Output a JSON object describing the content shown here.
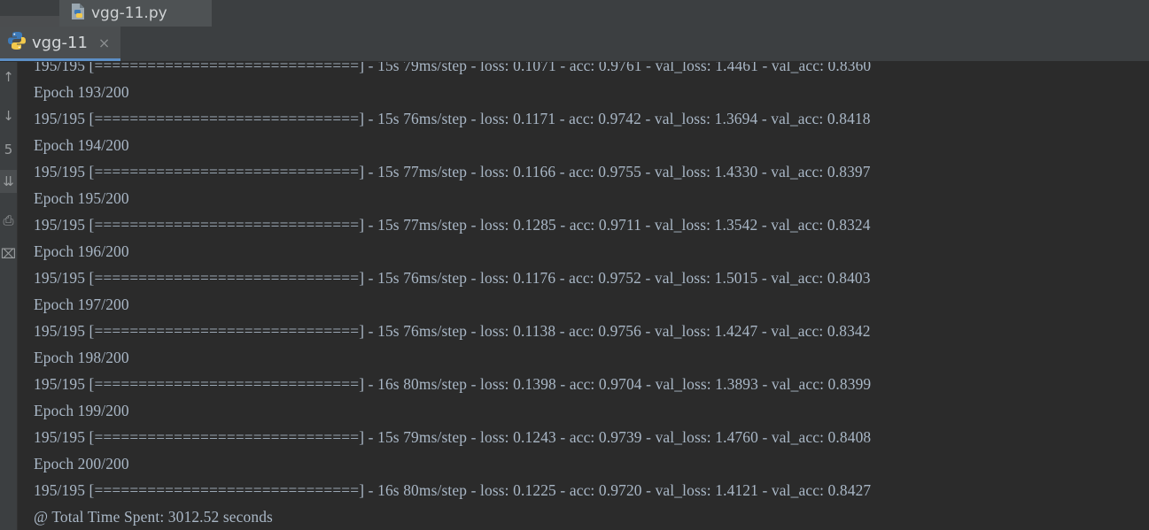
{
  "editor_tab": {
    "label": "vgg-11.py",
    "icon": "python-file-icon"
  },
  "run_tab": {
    "label": "vgg-11",
    "icon": "python-run-icon",
    "close_glyph": "×"
  },
  "gutter_buttons": [
    {
      "name": "up-arrow-icon",
      "glyph": "↑"
    },
    {
      "name": "down-arrow-icon",
      "glyph": "↓"
    },
    {
      "name": "rerun-icon",
      "glyph": "5"
    },
    {
      "name": "scroll-to-end-icon",
      "glyph": "⇊"
    },
    {
      "name": "print-icon",
      "glyph": "⎙"
    },
    {
      "name": "trash-icon",
      "glyph": "⌧"
    }
  ],
  "console": {
    "lines": [
      "195/195 [==============================] - 15s 79ms/step - loss: 0.1071 - acc: 0.9761 - val_loss: 1.4461 - val_acc: 0.8360",
      "Epoch 193/200",
      "195/195 [==============================] - 15s 76ms/step - loss: 0.1171 - acc: 0.9742 - val_loss: 1.3694 - val_acc: 0.8418",
      "Epoch 194/200",
      "195/195 [==============================] - 15s 77ms/step - loss: 0.1166 - acc: 0.9755 - val_loss: 1.4330 - val_acc: 0.8397",
      "Epoch 195/200",
      "195/195 [==============================] - 15s 77ms/step - loss: 0.1285 - acc: 0.9711 - val_loss: 1.3542 - val_acc: 0.8324",
      "Epoch 196/200",
      "195/195 [==============================] - 15s 76ms/step - loss: 0.1176 - acc: 0.9752 - val_loss: 1.5015 - val_acc: 0.8403",
      "Epoch 197/200",
      "195/195 [==============================] - 15s 76ms/step - loss: 0.1138 - acc: 0.9756 - val_loss: 1.4247 - val_acc: 0.8342",
      "Epoch 198/200",
      "195/195 [==============================] - 16s 80ms/step - loss: 0.1398 - acc: 0.9704 - val_loss: 1.3893 - val_acc: 0.8399",
      "Epoch 199/200",
      "195/195 [==============================] - 15s 79ms/step - loss: 0.1243 - acc: 0.9739 - val_loss: 1.4760 - val_acc: 0.8408",
      "Epoch 200/200",
      "195/195 [==============================] - 16s 80ms/step - loss: 0.1225 - acc: 0.9720 - val_loss: 1.4121 - val_acc: 0.8427",
      "@ Total Time Spent: 3012.52 seconds"
    ]
  },
  "colors": {
    "background": "#2b2b2b",
    "text": "#a9b7c6",
    "tab_active": "#4e5254",
    "accent": "#5c8fc6"
  }
}
